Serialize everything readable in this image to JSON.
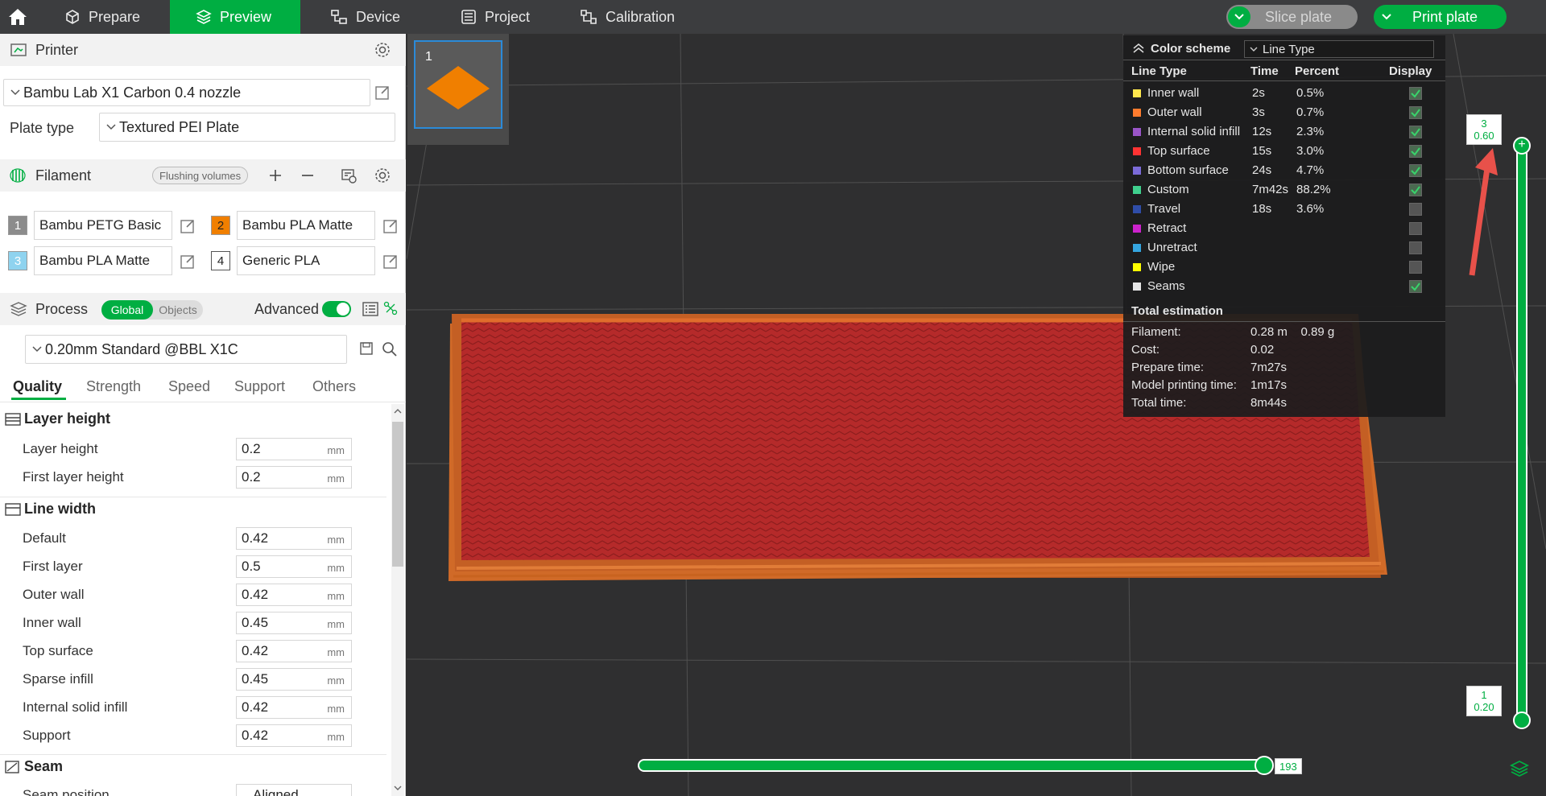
{
  "topbar": {
    "tabs": [
      {
        "label": "Prepare",
        "icon": "cube-icon"
      },
      {
        "label": "Preview",
        "icon": "layers-icon"
      },
      {
        "label": "Device",
        "icon": "device-icon"
      },
      {
        "label": "Project",
        "icon": "project-icon"
      },
      {
        "label": "Calibration",
        "icon": "calibration-icon"
      }
    ],
    "slice_label": "Slice plate",
    "print_label": "Print plate",
    "accent": "#00ae42"
  },
  "printer": {
    "title": "Printer",
    "selected": "Bambu Lab X1 Carbon 0.4 nozzle",
    "plate_type_label": "Plate type",
    "plate_type": "Textured PEI Plate"
  },
  "filament": {
    "title": "Filament",
    "flushing_label": "Flushing volumes",
    "slots": [
      {
        "num": "1",
        "name": "Bambu PETG Basic",
        "color": "#8c8c8c"
      },
      {
        "num": "2",
        "name": "Bambu PLA Matte",
        "color": "#f07f00"
      },
      {
        "num": "3",
        "name": "Bambu PLA Matte",
        "color": "#8fd3ef"
      },
      {
        "num": "4",
        "name": "Generic PLA",
        "color": "#ffffff"
      }
    ]
  },
  "process": {
    "title": "Process",
    "global_label": "Global",
    "objects_label": "Objects",
    "advanced_label": "Advanced",
    "preset": "0.20mm Standard @BBL X1C",
    "tabs": [
      "Quality",
      "Strength",
      "Speed",
      "Support",
      "Others"
    ],
    "groups": {
      "layer_height": {
        "title": "Layer height",
        "rows": [
          {
            "label": "Layer height",
            "value": "0.2",
            "unit": "mm"
          },
          {
            "label": "First layer height",
            "value": "0.2",
            "unit": "mm"
          }
        ]
      },
      "line_width": {
        "title": "Line width",
        "rows": [
          {
            "label": "Default",
            "value": "0.42",
            "unit": "mm"
          },
          {
            "label": "First layer",
            "value": "0.5",
            "unit": "mm"
          },
          {
            "label": "Outer wall",
            "value": "0.42",
            "unit": "mm"
          },
          {
            "label": "Inner wall",
            "value": "0.45",
            "unit": "mm"
          },
          {
            "label": "Top surface",
            "value": "0.42",
            "unit": "mm"
          },
          {
            "label": "Sparse infill",
            "value": "0.45",
            "unit": "mm"
          },
          {
            "label": "Internal solid infill",
            "value": "0.42",
            "unit": "mm"
          },
          {
            "label": "Support",
            "value": "0.42",
            "unit": "mm"
          }
        ]
      },
      "seam": {
        "title": "Seam",
        "rows": [
          {
            "label": "Seam position",
            "value": "Aligned"
          }
        ]
      }
    }
  },
  "plate": {
    "number": "1"
  },
  "legend": {
    "color_scheme_label": "Color scheme",
    "color_scheme_value": "Line Type",
    "headers": [
      "Line Type",
      "Time",
      "Percent",
      "Display"
    ],
    "rows": [
      {
        "name": "Inner wall",
        "time": "2s",
        "percent": "0.5%",
        "color": "#ffe74d",
        "on": true
      },
      {
        "name": "Outer wall",
        "time": "3s",
        "percent": "0.7%",
        "color": "#ff7c2e",
        "on": true
      },
      {
        "name": "Internal solid infill",
        "time": "12s",
        "percent": "2.3%",
        "color": "#9a55c8",
        "on": true
      },
      {
        "name": "Top surface",
        "time": "15s",
        "percent": "3.0%",
        "color": "#ff3333",
        "on": true
      },
      {
        "name": "Bottom surface",
        "time": "24s",
        "percent": "4.7%",
        "color": "#7b6bd8",
        "on": true
      },
      {
        "name": "Custom",
        "time": "7m42s",
        "percent": "88.2%",
        "color": "#3fcf8d",
        "on": true
      },
      {
        "name": "Travel",
        "time": "18s",
        "percent": "3.6%",
        "color": "#2f4da8",
        "on": false
      },
      {
        "name": "Retract",
        "time": "",
        "percent": "",
        "color": "#cc22cc",
        "on": false
      },
      {
        "name": "Unretract",
        "time": "",
        "percent": "",
        "color": "#35a6e0",
        "on": false
      },
      {
        "name": "Wipe",
        "time": "",
        "percent": "",
        "color": "#ffff00",
        "on": false
      },
      {
        "name": "Seams",
        "time": "",
        "percent": "",
        "color": "#e6e6e6",
        "on": true
      }
    ],
    "total_title": "Total estimation",
    "estimation": [
      {
        "label": "Filament:",
        "value": "0.28 m    0.89 g"
      },
      {
        "label": "Cost:",
        "value": "0.02"
      },
      {
        "label": "Prepare time:",
        "value": "7m27s"
      },
      {
        "label": "Model printing time:",
        "value": "1m17s"
      },
      {
        "label": "Total time:",
        "value": "8m44s"
      }
    ]
  },
  "layer_slider": {
    "top_layer": "3",
    "top_height": "0.60",
    "bottom_layer": "1",
    "bottom_height": "0.20"
  },
  "move_slider": {
    "value": "193"
  }
}
